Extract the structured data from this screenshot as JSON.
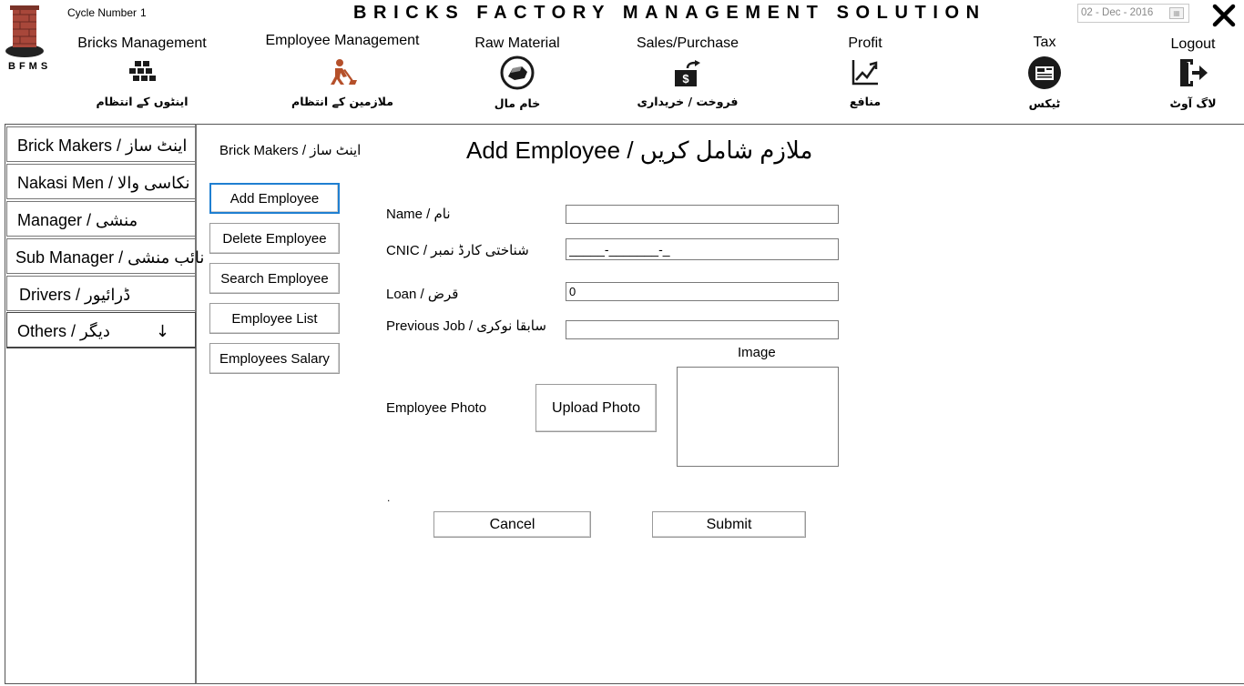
{
  "header": {
    "cycle_label": "Cycle Number",
    "cycle_value": "1",
    "logo_text": "BFMS",
    "app_title": "BRICKS FACTORY MANAGEMENT SOLUTION",
    "date_value": "02 - Dec - 2016"
  },
  "nav": [
    {
      "label": "Bricks Management",
      "urdu": "اینٹوں کے انتظام",
      "icon": "bricks-icon"
    },
    {
      "label": "Employee Management",
      "urdu": "ملازمین کے انتظام",
      "icon": "worker-icon"
    },
    {
      "label": "Raw Material",
      "urdu": "خام مال",
      "icon": "raw-material-icon"
    },
    {
      "label": "Sales/Purchase",
      "urdu": "فروخت / خریداری",
      "icon": "money-transfer-icon"
    },
    {
      "label": "Profit",
      "urdu": "منافع",
      "icon": "profit-chart-icon"
    },
    {
      "label": "Tax",
      "urdu": "ٹیکس",
      "icon": "tax-icon"
    },
    {
      "label": "Logout",
      "urdu": "لاگ آوٹ",
      "icon": "logout-icon"
    }
  ],
  "sidebar": {
    "items": [
      {
        "label": "Brick Makers / اینٹ ساز"
      },
      {
        "label": "Nakasi Men / نکاسی والا"
      },
      {
        "label": "Manager / منشی"
      },
      {
        "label": "Sub Manager / نائب منشی"
      },
      {
        "label": "Drivers / ڈرائیور"
      },
      {
        "label": "Others  /  دیگر"
      }
    ]
  },
  "submenu": {
    "title": "Brick Makers / اینٹ ساز",
    "buttons": [
      {
        "label": "Add Employee"
      },
      {
        "label": "Delete Employee"
      },
      {
        "label": "Search Employee"
      },
      {
        "label": "Employee List"
      },
      {
        "label": "Employees Salary"
      }
    ]
  },
  "form": {
    "title": "Add Employee / ملازم شامل کریں",
    "name_label": "Name / نام",
    "name_value": "",
    "cnic_label": "CNIC / شناختی کارڈ نمبر",
    "cnic_value": "_____-_______-_",
    "loan_label": "Loan / قرض",
    "loan_value": "0",
    "previous_job_label": "Previous Job /  سابقا نوکری",
    "previous_job_value": "",
    "image_label": "Image",
    "photo_label": "Employee Photo",
    "upload_label": "Upload Photo",
    "dot": ".",
    "cancel_label": "Cancel",
    "submit_label": "Submit"
  },
  "colors": {
    "accent_border": "#1f7fd1",
    "icon_dark": "#1a1a1a",
    "worker_icon": "#b5502a"
  }
}
